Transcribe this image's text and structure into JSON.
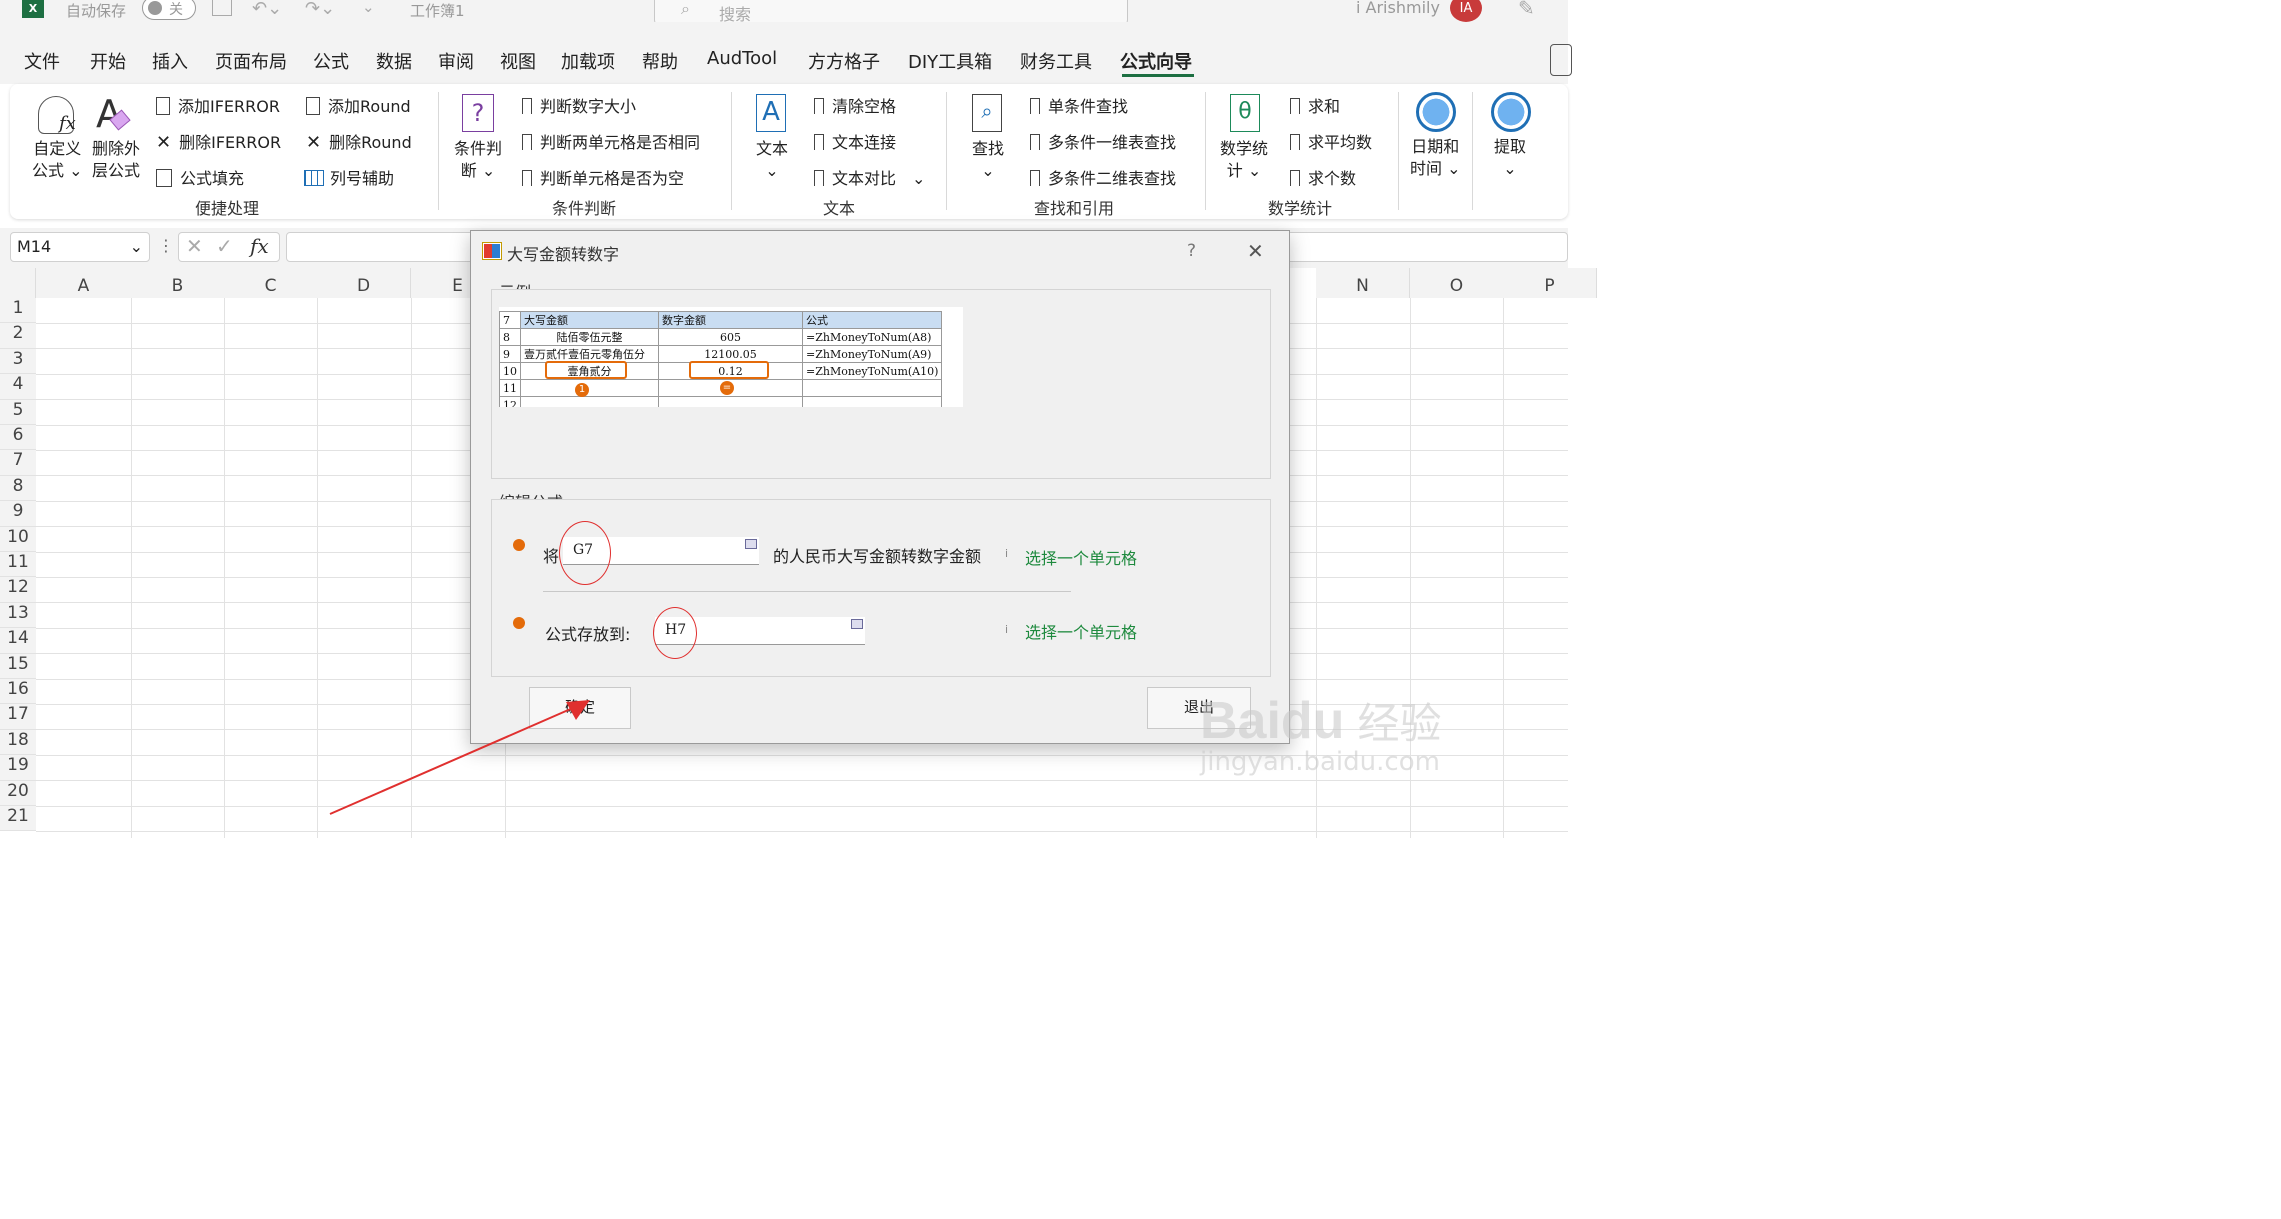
{
  "titlebar": {
    "autosave": "自动保存",
    "toggle": "关",
    "workbook": "工作簿1",
    "search": "搜索",
    "user": "i Arishmily",
    "avatar": "IA"
  },
  "menu": [
    "文件",
    "开始",
    "插入",
    "页面布局",
    "公式",
    "数据",
    "审阅",
    "视图",
    "加载项",
    "帮助",
    "AudTool",
    "方方格子",
    "DIY工具箱",
    "财务工具",
    "公式向导"
  ],
  "ribbon": {
    "custom_formula": [
      "自定义",
      "公式"
    ],
    "delete_outer": [
      "删除外",
      "层公式"
    ],
    "add_iferror": "添加IFERROR",
    "del_iferror": "删除IFERROR",
    "formula_fill": "公式填充",
    "add_round": "添加Round",
    "del_round": "删除Round",
    "col_helper": "列号辅助",
    "group1": "便捷处理",
    "cond": [
      "条件判",
      "断"
    ],
    "judge_num": "判断数字大小",
    "judge_same": "判断两单元格是否相同",
    "judge_empty": "判断单元格是否为空",
    "group2": "条件判断",
    "text": "文本",
    "clear_space": "清除空格",
    "text_join": "文本连接",
    "text_compare": "文本对比",
    "group3": "文本",
    "lookup": "查找",
    "single_lookup": "单条件查找",
    "multi_1d": "多条件一维表查找",
    "multi_2d": "多条件二维表查找",
    "group4": "查找和引用",
    "math": [
      "数学统",
      "计"
    ],
    "sum": "求和",
    "avg": "求平均数",
    "count": "求个数",
    "group5": "数学统计",
    "datetime": [
      "日期和",
      "时间"
    ],
    "extract": "提取"
  },
  "namebox": "M14",
  "fx": "fx",
  "columns": [
    "A",
    "B",
    "C",
    "D",
    "E",
    "N",
    "O",
    "P"
  ],
  "rows": [
    "1",
    "2",
    "3",
    "4",
    "5",
    "6",
    "7",
    "8",
    "9",
    "10",
    "11",
    "12",
    "13",
    "14",
    "15",
    "16",
    "17",
    "18",
    "19",
    "20",
    "21"
  ],
  "dialog": {
    "title": "大写金额转数字",
    "help": "?",
    "close": "✕",
    "example_label": "示例",
    "sample": {
      "header": [
        "7",
        "大写金额",
        "数字金额",
        "公式"
      ],
      "rows": [
        [
          "8",
          "陆佰零伍元整",
          "605",
          "=ZhMoneyToNum(A8)"
        ],
        [
          "9",
          "壹万贰仟壹佰元零角伍分",
          "12100.05",
          "=ZhMoneyToNum(A9)"
        ],
        [
          "10",
          "壹角贰分",
          "0.12",
          "=ZhMoneyToNum(A10)"
        ],
        [
          "11",
          "",
          "",
          ""
        ],
        [
          "12",
          "",
          "",
          ""
        ]
      ],
      "badge1": "1",
      "badge2": "="
    },
    "edit_label": "编辑公式",
    "row1_prefix": "将",
    "row1_value": "G7",
    "row1_suffix": "的人民币大写金额转数字金额",
    "row1_hint": "选择一个单元格",
    "row2_prefix": "公式存放到:",
    "row2_value": "H7",
    "row2_hint": "选择一个单元格",
    "ok": "确定",
    "exit": "退出"
  },
  "watermark": {
    "brand": "Baidu",
    "cn": "经验",
    "url": "jingyan.baidu.com"
  }
}
